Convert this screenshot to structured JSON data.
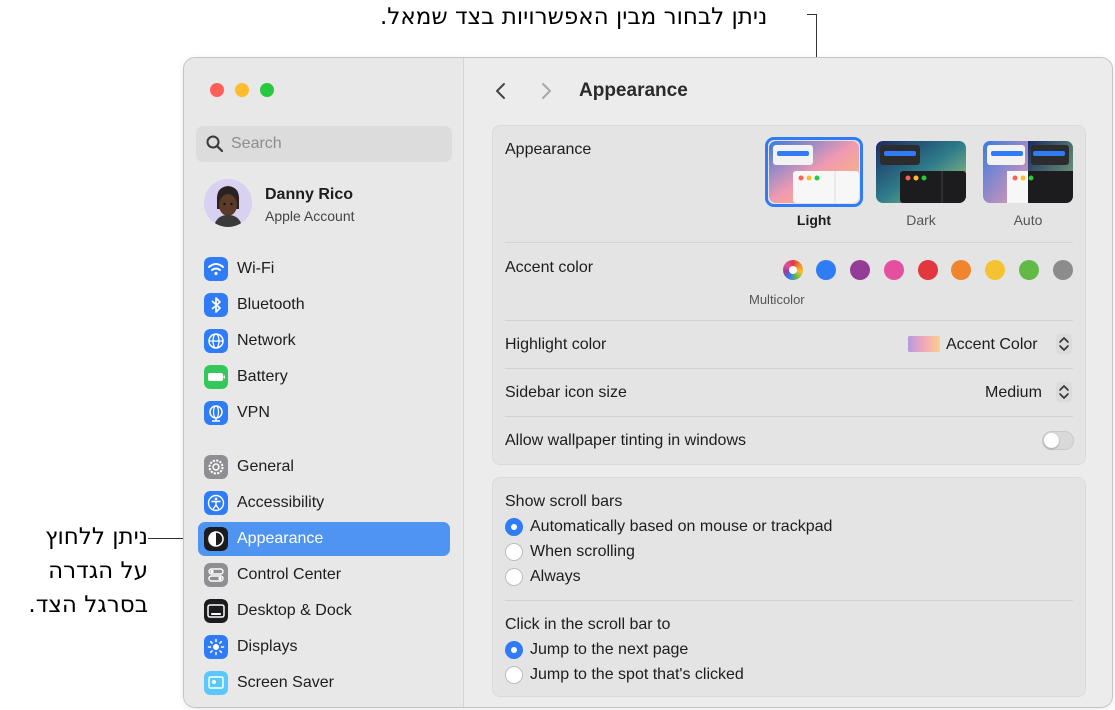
{
  "callouts": {
    "top": "ניתן לבחור מבין האפשרויות בצד שמאל.",
    "left_lines": [
      "ניתן ללחוץ",
      "על הגדרה",
      "בסרגל הצד."
    ]
  },
  "sidebar": {
    "search_placeholder": "Search",
    "account": {
      "name": "Danny Rico",
      "subtitle": "Apple Account"
    },
    "items": [
      {
        "label": "Wi-Fi",
        "icon": "wifi-icon",
        "color": "#2f7cf6"
      },
      {
        "label": "Bluetooth",
        "icon": "bluetooth-icon",
        "color": "#2f7cf6"
      },
      {
        "label": "Network",
        "icon": "globe-icon",
        "color": "#2f7cf6"
      },
      {
        "label": "Battery",
        "icon": "battery-icon",
        "color": "#34c759"
      },
      {
        "label": "VPN",
        "icon": "vpn-globe-icon",
        "color": "#2f7cf6"
      },
      {
        "label": "General",
        "icon": "gear-icon",
        "color": "#8e8e93"
      },
      {
        "label": "Accessibility",
        "icon": "accessibility-icon",
        "color": "#2f7cf6"
      },
      {
        "label": "Appearance",
        "icon": "appearance-icon",
        "color": "#1c1c1e",
        "selected": true
      },
      {
        "label": "Control Center",
        "icon": "control-center-icon",
        "color": "#8e8e93"
      },
      {
        "label": "Desktop & Dock",
        "icon": "desktop-dock-icon",
        "color": "#1c1c1e"
      },
      {
        "label": "Displays",
        "icon": "sun-icon",
        "color": "#2f7cf6"
      },
      {
        "label": "Screen Saver",
        "icon": "screen-saver-icon",
        "color": "#5ac8fa"
      }
    ]
  },
  "header": {
    "title": "Appearance"
  },
  "appearance": {
    "label": "Appearance",
    "options": [
      {
        "label": "Light",
        "selected": true
      },
      {
        "label": "Dark",
        "selected": false
      },
      {
        "label": "Auto",
        "selected": false
      }
    ]
  },
  "accent": {
    "label": "Accent color",
    "selected_name": "Multicolor",
    "colors": [
      "multicolor",
      "#2f7cf6",
      "#953d96",
      "#e54fa0",
      "#e0383e",
      "#f0852d",
      "#f5c231",
      "#62ba46",
      "#8c8c8c"
    ]
  },
  "highlight": {
    "label": "Highlight color",
    "value": "Accent Color"
  },
  "sidebar_icon_size": {
    "label": "Sidebar icon size",
    "value": "Medium"
  },
  "wallpaper_tinting": {
    "label": "Allow wallpaper tinting in windows",
    "on": false
  },
  "scroll_bars": {
    "label": "Show scroll bars",
    "options": [
      {
        "label": "Automatically based on mouse or trackpad",
        "selected": true
      },
      {
        "label": "When scrolling",
        "selected": false
      },
      {
        "label": "Always",
        "selected": false
      }
    ]
  },
  "click_scroll": {
    "label": "Click in the scroll bar to",
    "options": [
      {
        "label": "Jump to the next page",
        "selected": true
      },
      {
        "label": "Jump to the spot that's clicked",
        "selected": false
      }
    ]
  }
}
